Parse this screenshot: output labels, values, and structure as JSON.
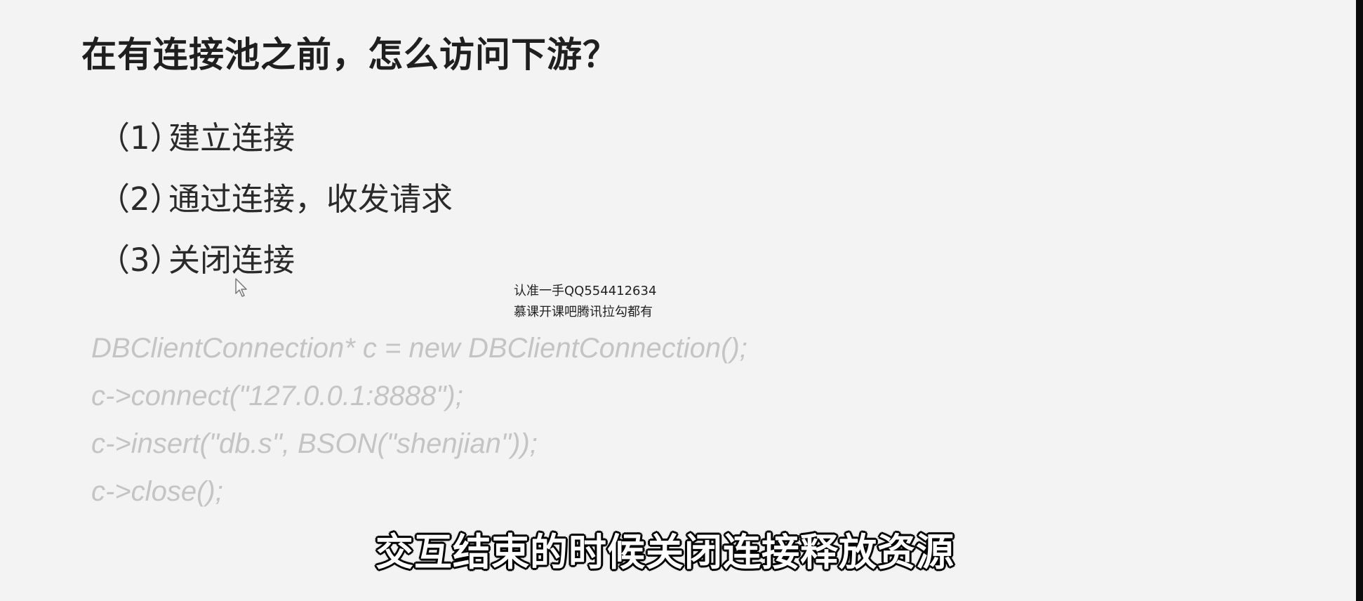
{
  "slide": {
    "title": "在有连接池之前，怎么访问下游？",
    "steps": [
      {
        "num": "（1）",
        "text": "建立连接"
      },
      {
        "num": "（2）",
        "text": "通过连接，收发请求"
      },
      {
        "num": "（3）",
        "text": "关闭连接"
      }
    ],
    "code_lines": [
      "DBClientConnection* c = new DBClientConnection();",
      "c->connect(\"127.0.0.1:8888\");",
      "c->insert(\"db.s\", BSON(\"shenjian\"));",
      "c->close();"
    ]
  },
  "watermark": {
    "line1": "认准一手QQ554412634",
    "line2": "慕课开课吧腾讯拉勾都有"
  },
  "subtitle": {
    "text": "交互结束的时候关闭连接释放资源"
  },
  "icons": {
    "cursor": "mouse-pointer-icon"
  }
}
